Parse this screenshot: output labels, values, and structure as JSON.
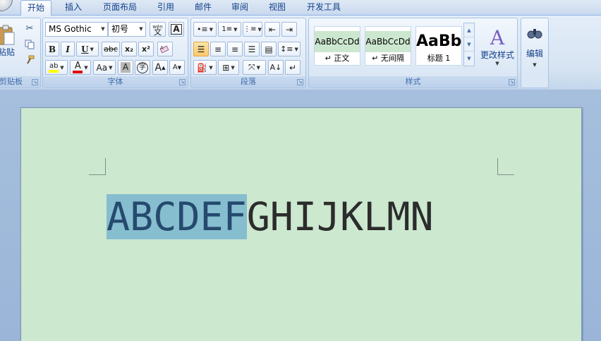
{
  "tabs": [
    {
      "label": "开始",
      "active": true
    },
    {
      "label": "插入"
    },
    {
      "label": "页面布局"
    },
    {
      "label": "引用"
    },
    {
      "label": "邮件"
    },
    {
      "label": "审阅"
    },
    {
      "label": "视图"
    },
    {
      "label": "开发工具"
    }
  ],
  "clipboard": {
    "paste_label": "粘贴",
    "group_label": "剪贴板"
  },
  "font": {
    "name": "MS Gothic",
    "size": "初号",
    "group_label": "字体",
    "bold": "B",
    "italic": "I",
    "underline": "U",
    "strike": "abc",
    "subscript": "x₂",
    "superscript": "x²",
    "phonetic": "wén",
    "phonetic_char": "文",
    "char_border": "A",
    "highlight": "ab",
    "font_color": "A",
    "change_case": "Aa",
    "char_shading": "A",
    "enclose": "字",
    "grow": "A",
    "shrink": "A",
    "highlight_color": "#ffff00",
    "font_color_value": "#e00000"
  },
  "paragraph": {
    "group_label": "段落"
  },
  "styles": {
    "group_label": "样式",
    "items": [
      {
        "sample": "AaBbCcDd",
        "name": "↵ 正文"
      },
      {
        "sample": "AaBbCcDd",
        "name": "↵ 无间隔"
      },
      {
        "sample": "AaBb",
        "name": "标题 1"
      }
    ],
    "change_label": "更改样式"
  },
  "editing": {
    "label": "编辑"
  },
  "document": {
    "selected_text": "ABCDEF",
    "rest_text": "GHIJKLMN"
  },
  "colors": {
    "page_background": "#cce8cf",
    "selection": "#86bdcf",
    "ribbon_accent": "#15428b"
  }
}
